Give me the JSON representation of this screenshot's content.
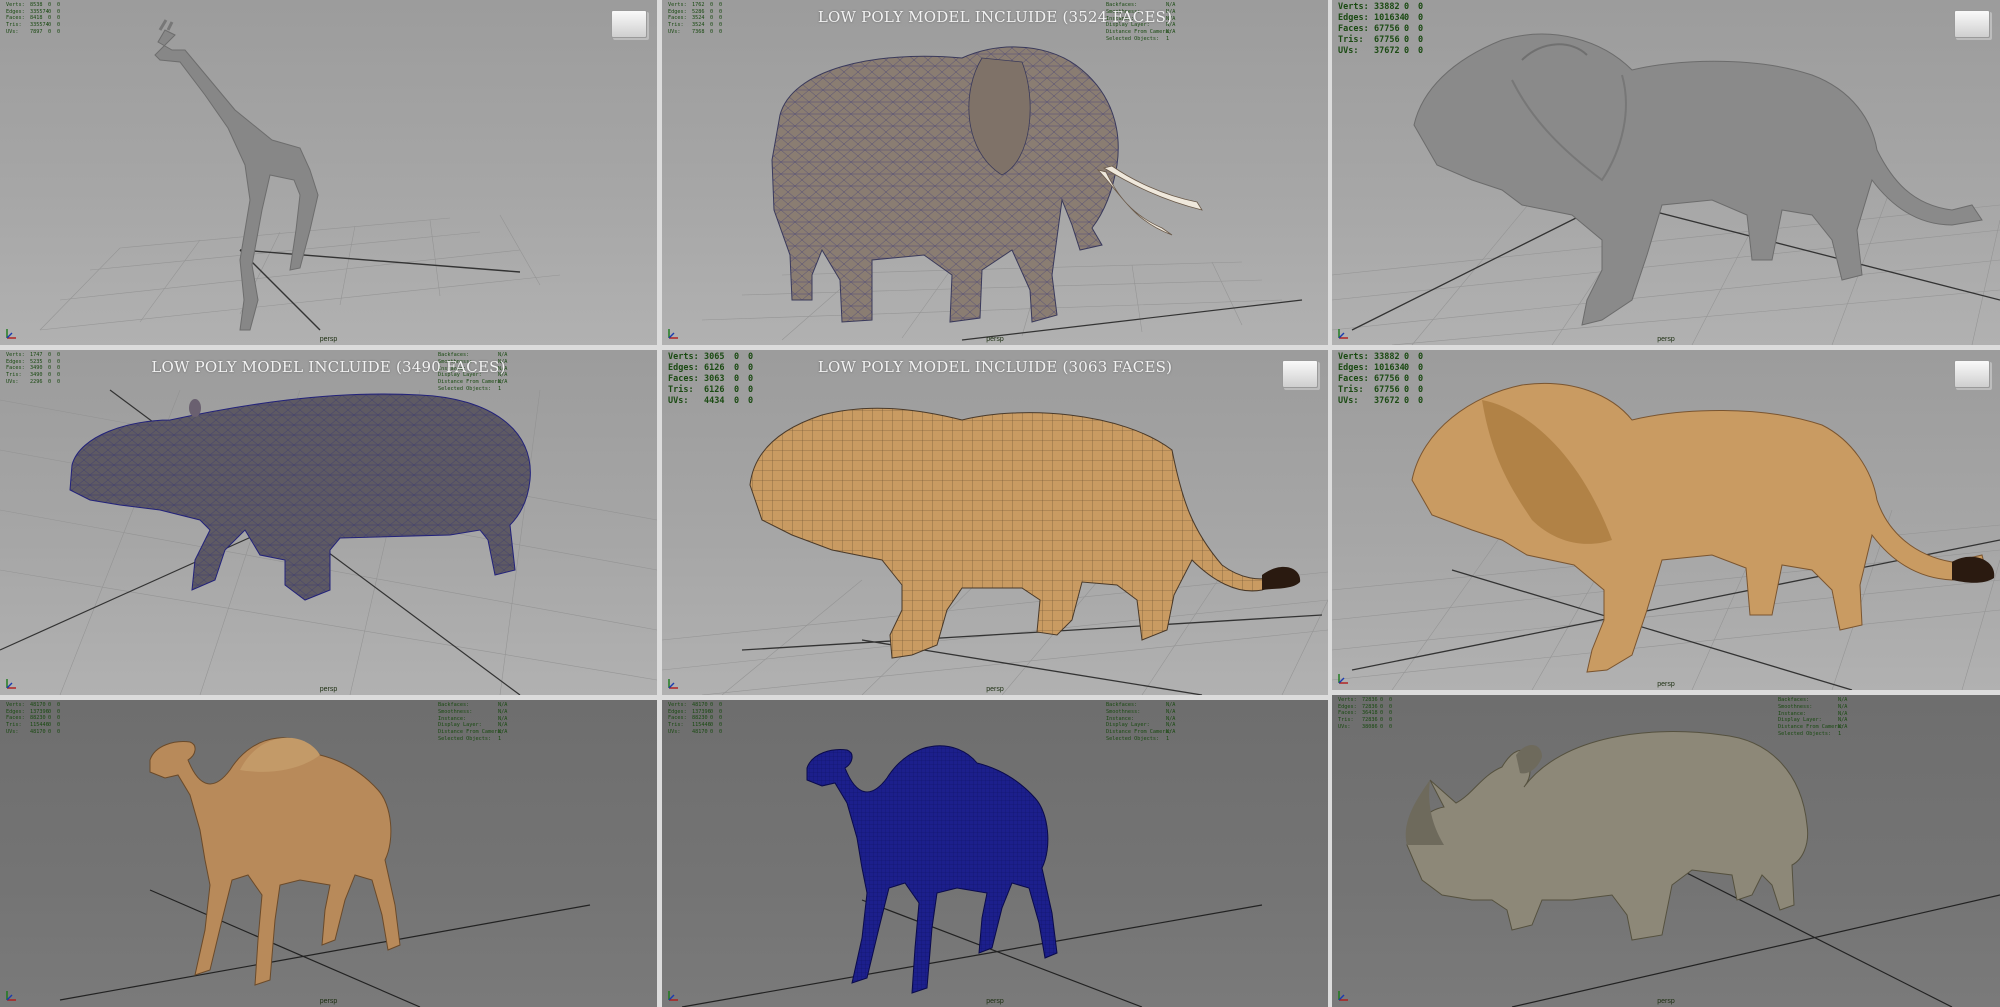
{
  "viewports": [
    {
      "id": "giraffe",
      "hud_size": "sm",
      "title": "",
      "camera": "persp",
      "viewcube": true,
      "dark": false,
      "stats": [
        [
          "Verts:",
          "8538",
          "0",
          "0"
        ],
        [
          "Edges:",
          "335574",
          "0",
          "0"
        ],
        [
          "Faces:",
          "8418",
          "0",
          "0"
        ],
        [
          "Tris:",
          "335574",
          "0",
          "0"
        ],
        [
          "UVs:",
          "7897",
          "0",
          "0"
        ]
      ],
      "display": []
    },
    {
      "id": "elephant",
      "hud_size": "sm",
      "title": "LOW POLY MODEL INCLUIDE (3524 FACES)",
      "camera": "persp",
      "viewcube": false,
      "dark": false,
      "stats": [
        [
          "Verts:",
          "1762",
          "0",
          "0"
        ],
        [
          "Edges:",
          "5286",
          "0",
          "0"
        ],
        [
          "Faces:",
          "3524",
          "0",
          "0"
        ],
        [
          "Tris:",
          "3524",
          "0",
          "0"
        ],
        [
          "UVs:",
          "7368",
          "0",
          "0"
        ]
      ],
      "display": [
        [
          "Backfaces:",
          "N/A"
        ],
        [
          "Smoothness:",
          "N/A"
        ],
        [
          "Instance:",
          "N/A"
        ],
        [
          "Display Layer:",
          "N/A"
        ],
        [
          "Distance From Camera:",
          "N/A"
        ],
        [
          "Selected Objects:",
          "1"
        ]
      ]
    },
    {
      "id": "lion-sculpt",
      "hud_size": "big",
      "title": "",
      "camera": "persp",
      "viewcube": true,
      "dark": false,
      "stats": [
        [
          "Verts:",
          "33882",
          "0",
          "0"
        ],
        [
          "Edges:",
          "101634",
          "0",
          "0"
        ],
        [
          "Faces:",
          "67756",
          "0",
          "0"
        ],
        [
          "Tris:",
          "67756",
          "0",
          "0"
        ],
        [
          "UVs:",
          "37672",
          "0",
          "0"
        ]
      ],
      "display": []
    },
    {
      "id": "hippo",
      "hud_size": "sm",
      "title": "LOW POLY MODEL INCLUIDE (3490 FACES)",
      "camera": "persp",
      "viewcube": false,
      "dark": false,
      "stats": [
        [
          "Verts:",
          "1747",
          "0",
          "0"
        ],
        [
          "Edges:",
          "5235",
          "0",
          "0"
        ],
        [
          "Faces:",
          "3490",
          "0",
          "0"
        ],
        [
          "Tris:",
          "3490",
          "0",
          "0"
        ],
        [
          "UVs:",
          "2296",
          "0",
          "0"
        ]
      ],
      "display": [
        [
          "Backfaces:",
          "N/A"
        ],
        [
          "Smoothness:",
          "N/A"
        ],
        [
          "Instance:",
          "N/A"
        ],
        [
          "Display Layer:",
          "N/A"
        ],
        [
          "Distance From Camera:",
          "N/A"
        ],
        [
          "Selected Objects:",
          "1"
        ]
      ]
    },
    {
      "id": "lion-wire",
      "hud_size": "big",
      "title": "LOW POLY MODEL INCLUIDE (3063 FACES)",
      "camera": "persp",
      "viewcube": true,
      "dark": false,
      "stats": [
        [
          "Verts:",
          "3065",
          "0",
          "0"
        ],
        [
          "Edges:",
          "6126",
          "0",
          "0"
        ],
        [
          "Faces:",
          "3063",
          "0",
          "0"
        ],
        [
          "Tris:",
          "6126",
          "0",
          "0"
        ],
        [
          "UVs:",
          "4434",
          "0",
          "0"
        ]
      ],
      "display": []
    },
    {
      "id": "lion-textured",
      "hud_size": "big",
      "title": "",
      "camera": "persp",
      "viewcube": true,
      "dark": false,
      "stats": [
        [
          "Verts:",
          "33882",
          "0",
          "0"
        ],
        [
          "Edges:",
          "101634",
          "0",
          "0"
        ],
        [
          "Faces:",
          "67756",
          "0",
          "0"
        ],
        [
          "Tris:",
          "67756",
          "0",
          "0"
        ],
        [
          "UVs:",
          "37672",
          "0",
          "0"
        ]
      ],
      "display": []
    },
    {
      "id": "camel-textured",
      "hud_size": "sm",
      "title": "",
      "camera": "persp",
      "viewcube": false,
      "dark": true,
      "stats": [
        [
          "Verts:",
          "48170",
          "0",
          "0"
        ],
        [
          "Edges:",
          "137396",
          "0",
          "0"
        ],
        [
          "Faces:",
          "88230",
          "0",
          "0"
        ],
        [
          "Tris:",
          "115446",
          "0",
          "0"
        ],
        [
          "UVs:",
          "48170",
          "0",
          "0"
        ]
      ],
      "display": [
        [
          "Backfaces:",
          "N/A"
        ],
        [
          "Smoothness:",
          "N/A"
        ],
        [
          "Instance:",
          "N/A"
        ],
        [
          "Display Layer:",
          "N/A"
        ],
        [
          "Distance From Camera:",
          "N/A"
        ],
        [
          "Selected Objects:",
          "1"
        ]
      ]
    },
    {
      "id": "camel-wire",
      "hud_size": "sm",
      "title": "",
      "camera": "persp",
      "viewcube": false,
      "dark": true,
      "stats": [
        [
          "Verts:",
          "48170",
          "0",
          "0"
        ],
        [
          "Edges:",
          "137396",
          "0",
          "0"
        ],
        [
          "Faces:",
          "88230",
          "0",
          "0"
        ],
        [
          "Tris:",
          "115446",
          "0",
          "0"
        ],
        [
          "UVs:",
          "48170",
          "0",
          "0"
        ]
      ],
      "display": [
        [
          "Backfaces:",
          "N/A"
        ],
        [
          "Smoothness:",
          "N/A"
        ],
        [
          "Instance:",
          "N/A"
        ],
        [
          "Display Layer:",
          "N/A"
        ],
        [
          "Distance From Camera:",
          "N/A"
        ],
        [
          "Selected Objects:",
          "1"
        ]
      ]
    },
    {
      "id": "rhino",
      "hud_size": "sm",
      "title": "",
      "camera": "persp",
      "viewcube": false,
      "dark": true,
      "stats": [
        [
          "Verts:",
          "72836",
          "0",
          "0"
        ],
        [
          "Edges:",
          "72836",
          "0",
          "0"
        ],
        [
          "Faces:",
          "36418",
          "0",
          "0"
        ],
        [
          "Tris:",
          "72836",
          "0",
          "0"
        ],
        [
          "UVs:",
          "38086",
          "0",
          "0"
        ]
      ],
      "display": [
        [
          "Backfaces:",
          "N/A"
        ],
        [
          "Smoothness:",
          "N/A"
        ],
        [
          "Instance:",
          "N/A"
        ],
        [
          "Display Layer:",
          "N/A"
        ],
        [
          "Distance From Camera:",
          "N/A"
        ],
        [
          "Selected Objects:",
          "1"
        ]
      ]
    }
  ],
  "colors": {
    "hud_text": "#1a4a12",
    "title_text": "#f2f2f2",
    "wire_blue": "#1c1f8c",
    "sculpt_gray": "#8a8a8a",
    "lion_tan": "#c99b62",
    "camel_tan": "#b88a5a",
    "hippo_skin": "#5e5a63",
    "elephant_skin": "#8a7d72",
    "rhino_skin": "#8d8878"
  }
}
